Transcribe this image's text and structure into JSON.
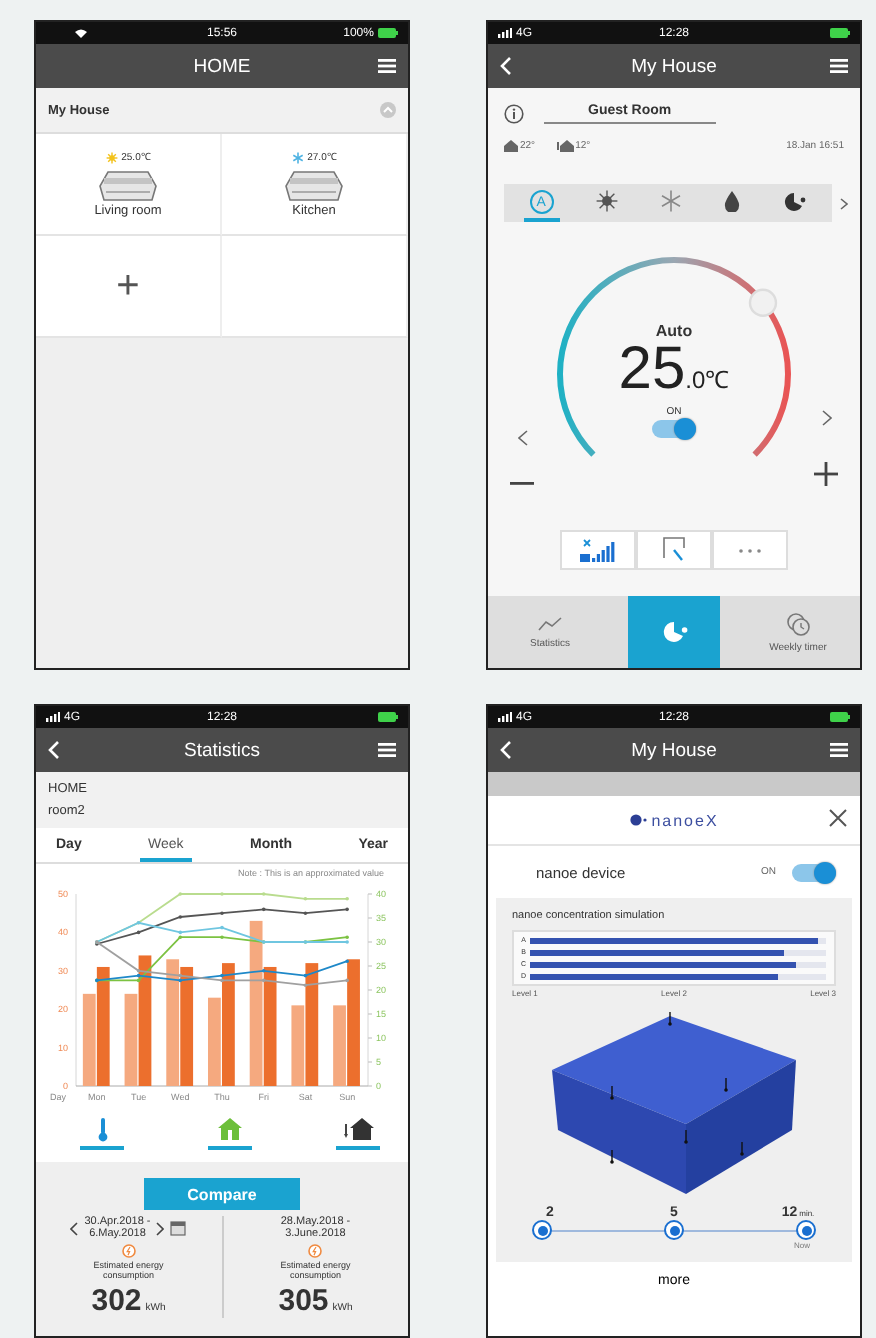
{
  "screens": [
    {
      "kind": "home",
      "status": {
        "time": "15:56",
        "battery": "100%"
      },
      "title": "HOME",
      "house": {
        "name": "My House",
        "expanded": true
      },
      "rooms": [
        {
          "name": "Living room",
          "temperature": "25.0℃",
          "kind": "heat"
        },
        {
          "name": "Kitchen",
          "temperature": "27.0℃",
          "kind": "cool"
        }
      ],
      "add_label": "+"
    },
    {
      "kind": "control",
      "status": {
        "network": "4G",
        "time": "12:28"
      },
      "title": "My House",
      "room": "Guest Room",
      "indoor": "22°",
      "outdoor": "12°",
      "datetime": "18.Jan 16:51",
      "modes": [
        {
          "kind": "auto",
          "symbol": "A",
          "selected": true
        },
        {
          "kind": "heat",
          "selected": false
        },
        {
          "kind": "cool",
          "selected": false
        },
        {
          "kind": "dry",
          "selected": false
        },
        {
          "kind": "nanoe",
          "selected": false
        }
      ],
      "dial": {
        "mode": "Auto",
        "whole": "25",
        "fraction": ".0",
        "unit": "℃",
        "level": 0.69,
        "power_label": "ON",
        "on": true
      },
      "functions": [
        {
          "kind": "fan"
        },
        {
          "kind": "swing"
        },
        {
          "kind": "more"
        }
      ],
      "nav": [
        {
          "kind": "statistics",
          "label": "Statistics",
          "selected": false
        },
        {
          "kind": "nanoe",
          "selected": true
        },
        {
          "kind": "timer",
          "label": "Weekly timer",
          "selected": false
        }
      ]
    },
    {
      "kind": "statistics",
      "status": {
        "network": "4G",
        "time": "12:28"
      },
      "title": "Statistics",
      "place": "HOME",
      "room": "room2",
      "tabs": [
        {
          "label": "Day",
          "selected": false
        },
        {
          "label": "Week",
          "selected": true
        },
        {
          "label": "Month",
          "selected": false
        },
        {
          "label": "Year",
          "selected": false
        }
      ],
      "note": "Note : This is an approximated value",
      "chart_data": {
        "type": "bar",
        "xlabel": "Day",
        "categories": [
          "Mon",
          "Tue",
          "Wed",
          "Thu",
          "Fri",
          "Sat",
          "Sun"
        ],
        "ylim": [
          0,
          50
        ],
        "yticks": [
          0,
          10,
          20,
          30,
          40,
          50
        ],
        "y2lim": [
          0,
          40
        ],
        "y2ticks": [
          0,
          5,
          10,
          15,
          20,
          25,
          30,
          35,
          40
        ],
        "series": [
          {
            "type": "bar",
            "color": "#f5a97f",
            "values": [
              24,
              24,
              33,
              23,
              43,
              21,
              21
            ]
          },
          {
            "type": "bar",
            "color": "#ec6f2d",
            "values": [
              31,
              34,
              31,
              32,
              31,
              32,
              33
            ]
          },
          {
            "type": "line",
            "axis": "y2",
            "color": "#555555",
            "values": [
              29.6,
              32,
              35.2,
              36,
              36.8,
              36,
              36.8
            ]
          },
          {
            "type": "line",
            "axis": "y2",
            "color": "#b9dc8e",
            "values": [
              30,
              34,
              40,
              40,
              40,
              39,
              39
            ]
          },
          {
            "type": "line",
            "axis": "y2",
            "color": "#7cc242",
            "values": [
              22,
              22,
              31,
              31,
              30,
              30,
              31
            ]
          },
          {
            "type": "line",
            "axis": "y2",
            "color": "#6fc6e0",
            "values": [
              30,
              34,
              32,
              33,
              30,
              30,
              30
            ]
          },
          {
            "type": "line",
            "axis": "y2",
            "color": "#1e88c8",
            "values": [
              22,
              23,
              22,
              23,
              24,
              23,
              26
            ]
          },
          {
            "type": "line",
            "axis": "y2",
            "color": "#a0a0a0",
            "values": [
              30,
              24,
              23,
              22,
              22,
              21,
              22
            ]
          }
        ]
      },
      "legend": [
        {
          "kind": "indoor",
          "on": true
        },
        {
          "kind": "home",
          "on": true
        },
        {
          "kind": "outdoor",
          "on": true
        }
      ],
      "compare_label": "Compare",
      "periods": [
        {
          "range_start": "30.Apr.2018 -",
          "range_end": "6.May.2018",
          "navigable": true,
          "caption": "Estimated energy consumption",
          "value": "302",
          "unit": "kWh"
        },
        {
          "range_start": "28.May.2018 -",
          "range_end": "3.June.2018",
          "navigable": false,
          "caption": "Estimated energy consumption",
          "value": "305",
          "unit": "kWh"
        }
      ]
    },
    {
      "kind": "nanoe",
      "status": {
        "network": "4G",
        "time": "12:28"
      },
      "title": "My House",
      "logo": "nanoeX",
      "device": {
        "label": "nanoe device",
        "state_label": "ON",
        "on": true
      },
      "simulation": {
        "title": "nanoe concentration simulation",
        "bars": [
          {
            "label": "A",
            "level": 0.97
          },
          {
            "label": "B",
            "level": 0.86
          },
          {
            "label": "C",
            "level": 0.9
          },
          {
            "label": "D",
            "level": 0.84
          }
        ],
        "scale": [
          "Level 1",
          "Level 2",
          "Level 3"
        ]
      },
      "timeline": [
        {
          "value": "2"
        },
        {
          "value": "5"
        },
        {
          "value": "12",
          "unit": "min.",
          "caption": "Now"
        }
      ],
      "more_label": "more"
    }
  ]
}
